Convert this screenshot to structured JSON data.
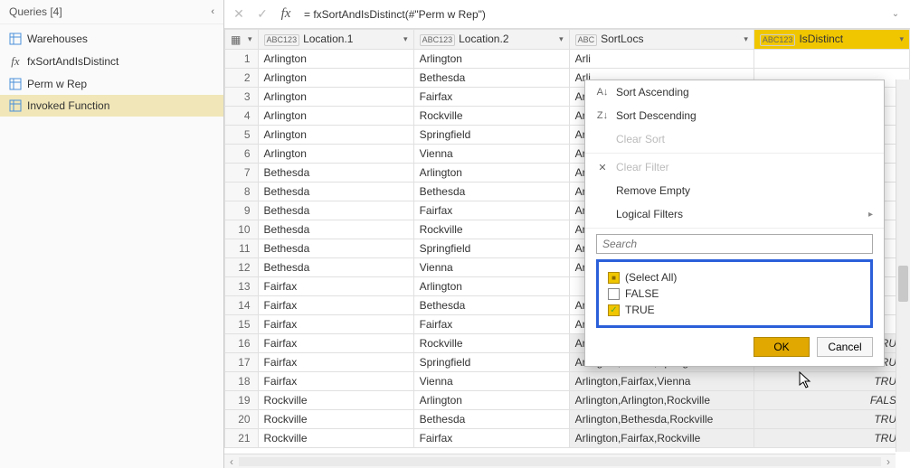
{
  "queries": {
    "header": "Queries [4]",
    "items": [
      {
        "label": "Warehouses",
        "icon": "table"
      },
      {
        "label": "fxSortAndIsDistinct",
        "icon": "fx"
      },
      {
        "label": "Perm w Rep",
        "icon": "table"
      },
      {
        "label": "Invoked Function",
        "icon": "table",
        "selected": true
      }
    ]
  },
  "formula": "= fxSortAndIsDistinct(#\"Perm w Rep\")",
  "columns": {
    "rowicon": "",
    "location1": {
      "type": "ABC123",
      "label": "Location.1"
    },
    "location2": {
      "type": "ABC123",
      "label": "Location.2"
    },
    "sortlocs": {
      "type": "ABC",
      "label": "SortLocs"
    },
    "isdistinct": {
      "type": "ABC123",
      "label": "IsDistinct",
      "selected": true
    }
  },
  "rows": [
    {
      "n": 1,
      "l1": "Arlington",
      "l2": "Arlington",
      "s": "Arli",
      "d": ""
    },
    {
      "n": 2,
      "l1": "Arlington",
      "l2": "Bethesda",
      "s": "Arli",
      "d": ""
    },
    {
      "n": 3,
      "l1": "Arlington",
      "l2": "Fairfax",
      "s": "Arli",
      "d": ""
    },
    {
      "n": 4,
      "l1": "Arlington",
      "l2": "Rockville",
      "s": "Arli",
      "d": ""
    },
    {
      "n": 5,
      "l1": "Arlington",
      "l2": "Springfield",
      "s": "Arli",
      "d": ""
    },
    {
      "n": 6,
      "l1": "Arlington",
      "l2": "Vienna",
      "s": "Arli",
      "d": ""
    },
    {
      "n": 7,
      "l1": "Bethesda",
      "l2": "Arlington",
      "s": "Arli",
      "d": ""
    },
    {
      "n": 8,
      "l1": "Bethesda",
      "l2": "Bethesda",
      "s": "Arli",
      "d": ""
    },
    {
      "n": 9,
      "l1": "Bethesda",
      "l2": "Fairfax",
      "s": "Arli",
      "d": ""
    },
    {
      "n": 10,
      "l1": "Bethesda",
      "l2": "Rockville",
      "s": "Arli",
      "d": ""
    },
    {
      "n": 11,
      "l1": "Bethesda",
      "l2": "Springfield",
      "s": "Arli",
      "d": ""
    },
    {
      "n": 12,
      "l1": "Bethesda",
      "l2": "Vienna",
      "s": "Arli",
      "d": ""
    },
    {
      "n": 13,
      "l1": "Fairfax",
      "l2": "Arlington",
      "s": "",
      "d": ""
    },
    {
      "n": 14,
      "l1": "Fairfax",
      "l2": "Bethesda",
      "s": "Arli",
      "d": ""
    },
    {
      "n": 15,
      "l1": "Fairfax",
      "l2": "Fairfax",
      "s": "Arli",
      "d": ""
    },
    {
      "n": 16,
      "l1": "Fairfax",
      "l2": "Rockville",
      "s": "Arlington,Fairfax,Rockville",
      "d": "TRUE",
      "shaded": true
    },
    {
      "n": 17,
      "l1": "Fairfax",
      "l2": "Springfield",
      "s": "Arlington,Fairfax,Springfield",
      "d": "TRUE",
      "shaded": true
    },
    {
      "n": 18,
      "l1": "Fairfax",
      "l2": "Vienna",
      "s": "Arlington,Fairfax,Vienna",
      "d": "TRUE",
      "shaded": true
    },
    {
      "n": 19,
      "l1": "Rockville",
      "l2": "Arlington",
      "s": "Arlington,Arlington,Rockville",
      "d": "FALSE",
      "shaded": true
    },
    {
      "n": 20,
      "l1": "Rockville",
      "l2": "Bethesda",
      "s": "Arlington,Bethesda,Rockville",
      "d": "TRUE",
      "shaded": true
    },
    {
      "n": 21,
      "l1": "Rockville",
      "l2": "Fairfax",
      "s": "Arlington,Fairfax,Rockville",
      "d": "TRUE",
      "shaded": true
    }
  ],
  "filterMenu": {
    "sortAsc": "Sort Ascending",
    "sortDesc": "Sort Descending",
    "clearSort": "Clear Sort",
    "clearFilter": "Clear Filter",
    "removeEmpty": "Remove Empty",
    "logicalFilters": "Logical Filters",
    "searchPlaceholder": "Search",
    "options": {
      "selectAll": "(Select All)",
      "falseLabel": "FALSE",
      "trueLabel": "TRUE"
    },
    "ok": "OK",
    "cancel": "Cancel"
  }
}
